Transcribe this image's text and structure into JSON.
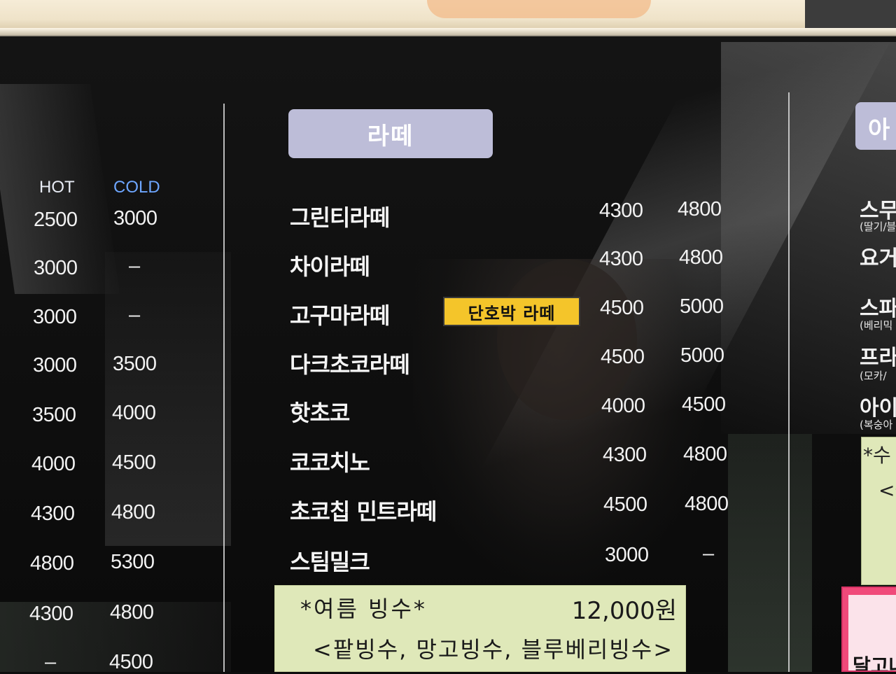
{
  "left_column": {
    "headers": {
      "hot": "HOT",
      "cold": "COLD"
    },
    "rows": [
      {
        "hot": "2500",
        "cold": "3000"
      },
      {
        "hot": "3000",
        "cold": "–"
      },
      {
        "hot": "3000",
        "cold": "–"
      },
      {
        "hot": "3000",
        "cold": "3500"
      },
      {
        "hot": "3500",
        "cold": "4000"
      },
      {
        "hot": "4000",
        "cold": "4500"
      },
      {
        "hot": "4300",
        "cold": "4800"
      },
      {
        "hot": "4800",
        "cold": "5300"
      },
      {
        "hot": "4300",
        "cold": "4800"
      },
      {
        "hot": "–",
        "cold": "4500"
      }
    ]
  },
  "latte_section": {
    "title": "라떼",
    "items": [
      {
        "name": "그린티라떼",
        "hot": "4300",
        "cold": "4800"
      },
      {
        "name": "차이라떼",
        "hot": "4300",
        "cold": "4800"
      },
      {
        "name": "고구마라떼",
        "hot": "4500",
        "cold": "5000"
      },
      {
        "name": "다크초코라떼",
        "hot": "4500",
        "cold": "5000"
      },
      {
        "name": "핫초코",
        "hot": "4000",
        "cold": "4500"
      },
      {
        "name": "코코치노",
        "hot": "4300",
        "cold": "4800"
      },
      {
        "name": "초코칩 민트라떼",
        "hot": "4500",
        "cold": "4800"
      },
      {
        "name": "스팀밀크",
        "hot": "3000",
        "cold": "–"
      }
    ],
    "sticker": "단호박 라떼"
  },
  "summer_note": {
    "title": "*여름 빙수*",
    "price": "12,000원",
    "items": "<팥빙수, 망고빙수, 블루베리빙수>"
  },
  "right_column_partial": {
    "title": "아",
    "items": [
      {
        "name": "스무",
        "sub": "(딸기/블"
      },
      {
        "name": "요거",
        "sub": ""
      },
      {
        "name": "스파",
        "sub": "(베리믹"
      },
      {
        "name": "프라",
        "sub": "(모카/"
      },
      {
        "name": "아이",
        "sub": "(복숭아"
      }
    ],
    "note": {
      "line1": "*수",
      "line2": "<블"
    },
    "pink_sign": "달고나"
  }
}
